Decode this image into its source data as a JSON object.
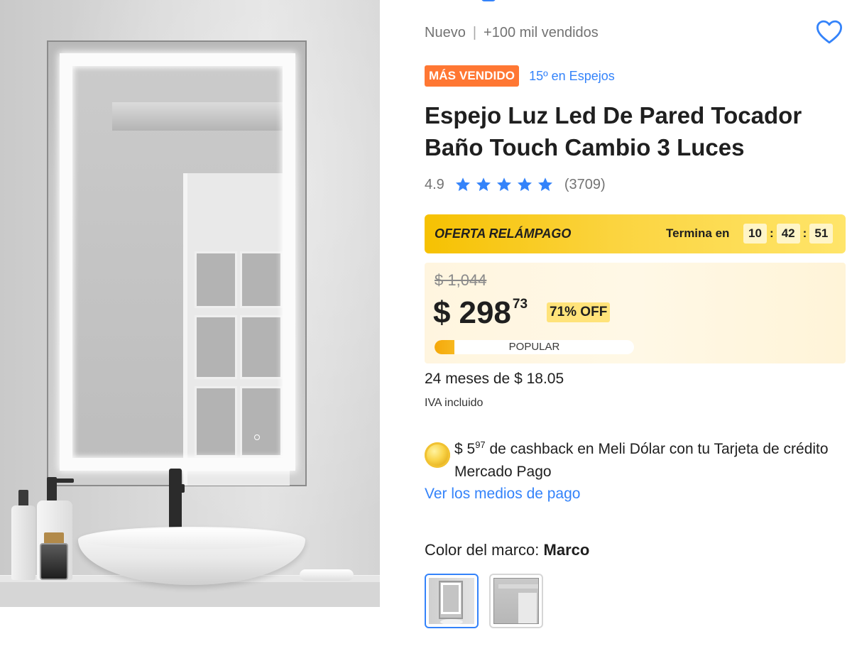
{
  "product": {
    "condition": "Nuevo",
    "sold": "+100 mil vendidos",
    "badge": "MÁS VENDIDO",
    "rank": "15º en Espejos",
    "title": "Espejo Luz Led De Pared Tocador Baño Touch Cambio 3 Luces",
    "rating": "4.9",
    "stars": 5,
    "reviews": "(3709)"
  },
  "flash_sale": {
    "label": "OFERTA RELÁMPAGO",
    "ends_label": "Termina en",
    "hours": "10",
    "minutes": "42",
    "seconds": "51"
  },
  "price": {
    "original": "$ 1,044",
    "currency": "$",
    "integer": "298",
    "cents": "73",
    "discount": "71% OFF",
    "popular_label": "POPULAR",
    "popular_level": 0.1
  },
  "installments": {
    "text": "24 meses de $ 18.05",
    "tax_note": "IVA incluido"
  },
  "cashback": {
    "currency": "$ 5",
    "cents": "97",
    "text": " de cashback en Meli Dólar con tu Tarjeta de crédito Mercado Pago"
  },
  "payment_link": "Ver los medios de pago",
  "variant": {
    "label": "Color del marco: ",
    "selected": "Marco"
  },
  "colors": {
    "accent": "#3483fa",
    "badge": "#ff7733",
    "flash": "#f6c102",
    "discount": "#ffe37a"
  },
  "icons": {
    "favorite": "heart-outline-icon",
    "star": "star-icon",
    "coin": "meli-dolar-coin-icon"
  }
}
